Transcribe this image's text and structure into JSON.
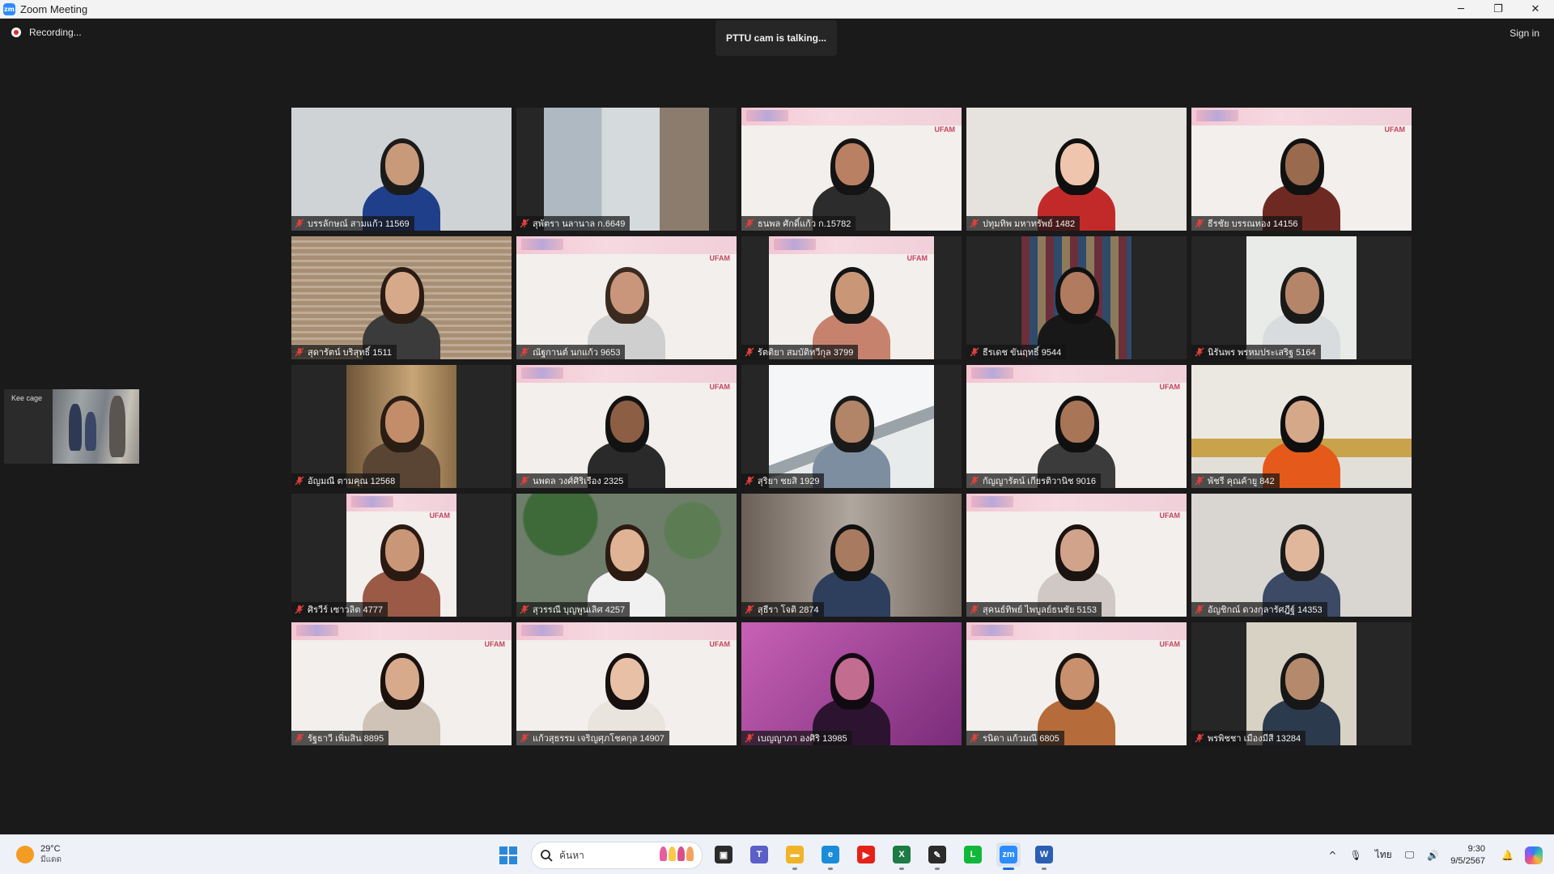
{
  "window": {
    "logo": "zm",
    "title": "Zoom Meeting",
    "controls": {
      "minimize": "─",
      "restore": "❐",
      "close": "✕"
    }
  },
  "meeting": {
    "recording_label": "Recording...",
    "talking_label": "PTTU cam is talking...",
    "signin_label": "Sign in"
  },
  "self_view": {
    "label": "Kee cage"
  },
  "slide": {
    "brand": "UFAM"
  },
  "participants": [
    {
      "name": "บรรลักษณ์ สามแก้ว 11569",
      "video": "full",
      "bg": "#cfd3d6",
      "scene": "room",
      "skin": "#c99a7a",
      "hair": "#1b1b1b",
      "shirt": "#1f3f8a"
    },
    {
      "name": "สุพัตรา นลานาล ก.6649",
      "video": "right-shift",
      "bg": "#b7c2ca",
      "scene": "door",
      "skin": "",
      "hair": "",
      "shirt": ""
    },
    {
      "name": "ธนพล ศักดิ์แก้ว ก.15782",
      "video": "full",
      "bg": "#f2efec",
      "scene": "slide",
      "skin": "#b98063",
      "hair": "#141414",
      "shirt": "#2c2c2c"
    },
    {
      "name": "ปทุมทิพ มหาทรัพย์ 1482",
      "video": "full",
      "bg": "#e6e3de",
      "scene": "office",
      "skin": "#f0c5ad",
      "hair": "#0f0f0f",
      "shirt": "#c22a2a"
    },
    {
      "name": "ธีรชัย บรรณทอง 14156",
      "video": "full",
      "bg": "#f2efec",
      "scene": "slide",
      "skin": "#9a6a4e",
      "hair": "#111111",
      "shirt": "#6e2a22"
    },
    {
      "name": "สุดารัตน์ บริสุทธิ์ 1511",
      "video": "full",
      "bg": "#a88f74",
      "scene": "blinds",
      "skin": "#d6a98a",
      "hair": "#2a1c14",
      "shirt": "#3b3b3b"
    },
    {
      "name": "ณัฐกานต์ นกแก้ว 9653",
      "video": "full",
      "bg": "#f2efec",
      "scene": "slide",
      "skin": "#c9967b",
      "hair": "#3a2a20",
      "shirt": "#cfcfcf"
    },
    {
      "name": "รัตติยา สมบัติทวีกุล 3799",
      "video": "center-mid",
      "bg": "#f2efec",
      "scene": "slide",
      "skin": "#c99778",
      "hair": "#141414",
      "shirt": "#c7826e"
    },
    {
      "name": "ธีรเดช ขันฤทธิ์ 9544",
      "video": "center-narrow",
      "bg": "#5d5a56",
      "scene": "closet",
      "skin": "#b07b5f",
      "hair": "#111111",
      "shirt": "#181818"
    },
    {
      "name": "นิรันพร พรหมประเสริฐ 5164",
      "video": "center-narrow",
      "bg": "#e9ebe8",
      "scene": "plain",
      "skin": "#b5856a",
      "hair": "#1a1a1a",
      "shirt": "#d9dcdf"
    },
    {
      "name": "อัญมณี ตามคุณ 12568",
      "video": "center-narrow",
      "bg": "#9a7b52",
      "scene": "warm",
      "skin": "#c38d6a",
      "hair": "#2a1d14",
      "shirt": "#5a4433"
    },
    {
      "name": "นพดล วงศ์ศิริเรือง 2325",
      "video": "full",
      "bg": "#f2efec",
      "scene": "slide",
      "skin": "#8c5e44",
      "hair": "#121212",
      "shirt": "#2a2a2a"
    },
    {
      "name": "สุริยา ชยสิ 1929",
      "video": "center-mid",
      "bg": "#dfe2e4",
      "scene": "ceiling",
      "skin": "#b28468",
      "hair": "#1a1a1a",
      "shirt": "#7d8ea0"
    },
    {
      "name": "กัญญารัตน์ เกียรติวานิช 9016",
      "video": "full",
      "bg": "#f2efec",
      "scene": "slide",
      "skin": "#a87557",
      "hair": "#101010",
      "shirt": "#3b3b3b"
    },
    {
      "name": "พัชรี คุณค้ายู 842",
      "video": "full",
      "bg": "#e2dfd9",
      "scene": "living",
      "skin": "#d6a88a",
      "hair": "#0f0f0f",
      "shirt": "#e55a1a"
    },
    {
      "name": "ศิรวีร์ เซาวลิต 4777",
      "video": "center-narrow",
      "bg": "#f2efec",
      "scene": "slide",
      "skin": "#c99778",
      "hair": "#2a1a12",
      "shirt": "#9a5a45"
    },
    {
      "name": "สุวรรณี บุญพูนเลิศ 4257",
      "video": "full",
      "bg": "#6f7e6a",
      "scene": "cafe",
      "skin": "#e0b394",
      "hair": "#2b1b12",
      "shirt": "#f1f1f1"
    },
    {
      "name": "สุธีรา โจติ 2874",
      "video": "full",
      "bg": "#8c8178",
      "scene": "blurred",
      "skin": "#a87a60",
      "hair": "#111111",
      "shirt": "#2d3f5c"
    },
    {
      "name": "สุคนธ์ทิพย์ ไพบูลย์ธนชัย 5153",
      "video": "full",
      "bg": "#f2efec",
      "scene": "slide",
      "skin": "#d1a38a",
      "hair": "#1a1310",
      "shirt": "#cfc8c4"
    },
    {
      "name": "อัญชิกณ์ ดวงกุลารัศฎีฐ์ 14353",
      "video": "full",
      "bg": "#d9d6d1",
      "scene": "plain",
      "skin": "#e1b79c",
      "hair": "#1a1a1a",
      "shirt": "#3c4a66"
    },
    {
      "name": "รัฐธาวี เพิ่มสิน 8895",
      "video": "full",
      "bg": "#f2efec",
      "scene": "slide",
      "skin": "#d7aa8c",
      "hair": "#1b120e",
      "shirt": "#cfc2b6"
    },
    {
      "name": "แก้วสุธรรม เจริญศุภโชคกุล 14907",
      "video": "full",
      "bg": "#f2efec",
      "scene": "slide",
      "skin": "#e7c0a6",
      "hair": "#161010",
      "shirt": "#e9e4de"
    },
    {
      "name": "เบญญาภา องศิริ 13985",
      "video": "full",
      "bg": "#a84c9a",
      "scene": "purple",
      "skin": "#c26d8f",
      "hair": "#120a12",
      "shirt": "#2c1430"
    },
    {
      "name": "รนิดา แก้วมณี 6805",
      "video": "full",
      "bg": "#f2efec",
      "scene": "slide",
      "skin": "#c8906c",
      "hair": "#1a1411",
      "shirt": "#b56b3a"
    },
    {
      "name": "พรพิชชา เมืองมีสี 13284",
      "video": "center-narrow",
      "bg": "#d8d2c4",
      "scene": "plain",
      "skin": "#b58a6c",
      "hair": "#171717",
      "shirt": "#2b3a4c"
    }
  ],
  "taskbar": {
    "weather": {
      "temp": "29°C",
      "condition": "มีแดด"
    },
    "search": {
      "placeholder": "ค้นหา"
    },
    "apps": [
      {
        "name": "task-view",
        "glyph": "▣",
        "color": "#2b2b2b",
        "state": ""
      },
      {
        "name": "teams",
        "glyph": "T",
        "color": "#5b5fc7",
        "state": ""
      },
      {
        "name": "file-explorer",
        "glyph": "▬",
        "color": "#f0b429",
        "state": "running"
      },
      {
        "name": "edge",
        "glyph": "e",
        "color": "#1b8dd8",
        "state": "running"
      },
      {
        "name": "youtube",
        "glyph": "▶",
        "color": "#e62117",
        "state": ""
      },
      {
        "name": "excel",
        "glyph": "X",
        "color": "#1d7b45",
        "state": "running"
      },
      {
        "name": "sticky-notes",
        "glyph": "✎",
        "color": "#2b2b2b",
        "state": "running"
      },
      {
        "name": "line",
        "glyph": "L",
        "color": "#10b83a",
        "state": ""
      },
      {
        "name": "zoom",
        "glyph": "zm",
        "color": "#2d8cff",
        "state": "active"
      },
      {
        "name": "word",
        "glyph": "W",
        "color": "#2b5fb4",
        "state": "running"
      }
    ],
    "tray": {
      "chevron": "^",
      "mic": "🎙",
      "language": "ไทย",
      "network": "🖵",
      "volume": "🔊",
      "time": "9:30",
      "date": "9/5/2567",
      "bell": "🔔"
    }
  }
}
